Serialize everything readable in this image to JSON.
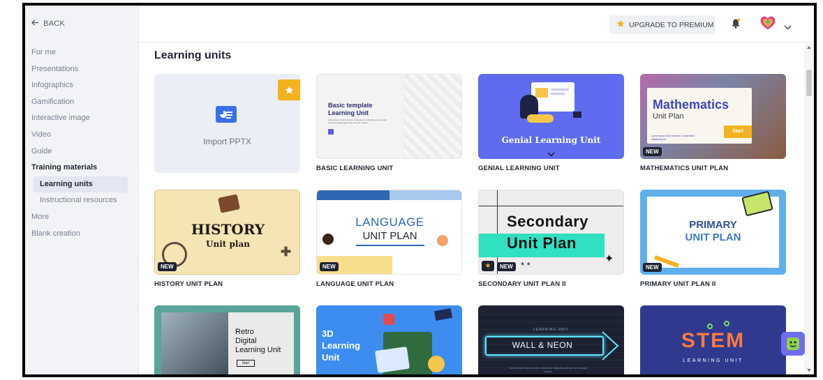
{
  "sidebar": {
    "back_label": "BACK",
    "items": [
      {
        "label": "For me"
      },
      {
        "label": "Presentations"
      },
      {
        "label": "Infographics"
      },
      {
        "label": "Gamification"
      },
      {
        "label": "Interactive image"
      },
      {
        "label": "Video"
      },
      {
        "label": "Guide"
      },
      {
        "label": "Training materials"
      },
      {
        "label": "Learning units"
      },
      {
        "label": "Instructional resources"
      },
      {
        "label": "More"
      },
      {
        "label": "Blank creation"
      }
    ]
  },
  "topbar": {
    "upgrade_label": "UPGRADE TO PREMIUM",
    "icons": [
      "star-icon",
      "bell-icon",
      "avatar-heart-icon",
      "chevron-down-icon"
    ]
  },
  "main": {
    "title": "Learning units",
    "import_label": "Import PPTX",
    "new_tag": "NEW",
    "cards": [
      {
        "caption": "BASIC LEARNING UNIT",
        "thumb_title": "Basic template",
        "thumb_subtitle": "Learning Unit",
        "thumb_body": "Lorem ipsum dolor sit amet, consectetur adipiscing elit. Aenean commodo ligula eget dolor. Aenean massa."
      },
      {
        "caption": "GENIAL LEARNING UNIT",
        "thumb_title": "Genial Learning Unit"
      },
      {
        "caption": "MATHEMATICS UNIT PLAN",
        "thumb_title": "Mathematics",
        "thumb_subtitle": "Unit Plan",
        "thumb_button": "Start",
        "thumb_body": "Lorem ipsum dolor sit amet, consectetur adipiscing elit"
      },
      {
        "caption": "HISTORY UNIT PLAN",
        "thumb_title": "HISTORY",
        "thumb_subtitle": "Unit plan"
      },
      {
        "caption": "LANGUAGE UNIT PLAN",
        "thumb_title": "LANGUAGE",
        "thumb_subtitle": "UNIT PLAN"
      },
      {
        "caption": "SECONDARY UNIT PLAN II",
        "thumb_title": "Secondary",
        "thumb_subtitle": "Unit Plan"
      },
      {
        "caption": "PRIMARY UNIT PLAN II",
        "thumb_title": "PRIMARY",
        "thumb_subtitle": "UNIT PLAN"
      },
      {
        "caption": "",
        "thumb_title": "Retro",
        "thumb_subtitle": "Digital",
        "thumb_line3": "Learning Unit",
        "thumb_button": "Start"
      },
      {
        "caption": "",
        "thumb_title": "3D",
        "thumb_subtitle": "Learning",
        "thumb_line3": "Unit"
      },
      {
        "caption": "",
        "thumb_kicker": "LEARNING UNIT",
        "thumb_title": "WALL & NEON",
        "thumb_body": "Lorem ipsum dolor sit amet, consectetur adipiscing elit, sed do eiusmod tempor"
      },
      {
        "caption": "",
        "thumb_title": "STEM",
        "thumb_subtitle": "LEARNING UNIT"
      }
    ]
  },
  "colors": {
    "accent": "#f2b320",
    "sidebar_bg": "#f1f3f7",
    "active_bg": "#e3e6f3",
    "genial_bg": "#5f6cf0",
    "stem_bg": "#2f3a8f"
  }
}
